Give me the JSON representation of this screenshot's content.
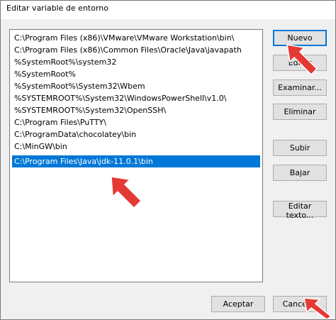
{
  "window": {
    "title": "Editar variable de entorno"
  },
  "list": {
    "items": [
      "C:\\Program Files (x86)\\VMware\\VMware Workstation\\bin\\",
      "C:\\Program Files (x86)\\Common Files\\Oracle\\Java\\javapath",
      "%SystemRoot%\\system32",
      "%SystemRoot%",
      "%SystemRoot%\\System32\\Wbem",
      "%SYSTEMROOT%\\System32\\WindowsPowerShell\\v1.0\\",
      "%SYSTEMROOT%\\System32\\OpenSSH\\",
      "C:\\Program Files\\PuTTY\\",
      "C:\\ProgramData\\chocolatey\\bin",
      "C:\\MinGW\\bin",
      "C:\\Program Files\\Java\\jdk-11.0.1\\bin"
    ],
    "selected_index": 10
  },
  "buttons": {
    "nuevo": "Nuevo",
    "editar": "Editar",
    "examinar": "Examinar...",
    "eliminar": "Eliminar",
    "subir": "Subir",
    "bajar": "Bajar",
    "editar_texto": "Editar texto...",
    "aceptar": "Aceptar",
    "cancelar": "Cancelar"
  },
  "colors": {
    "selection": "#0078d7",
    "annotation_arrow": "#e53935"
  }
}
